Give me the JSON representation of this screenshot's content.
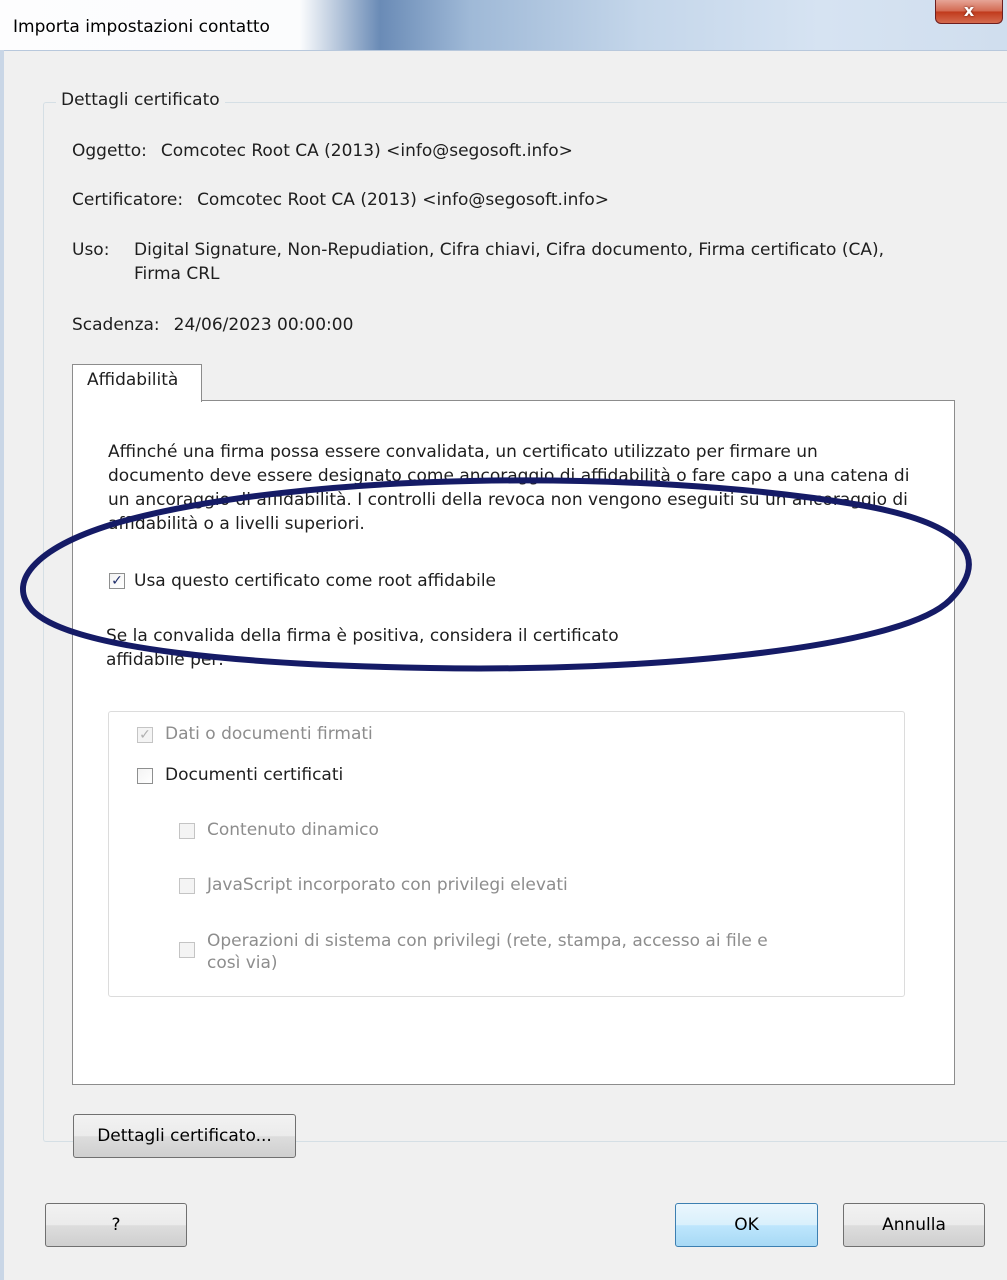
{
  "window": {
    "title": "Importa impostazioni contatto",
    "close_label": "x"
  },
  "details": {
    "legend": "Dettagli certificato",
    "subject_label": "Oggetto:",
    "subject_value": "Comcotec Root CA (2013) <info@segosoft.info>",
    "issuer_label": "Certificatore:",
    "issuer_value": "Comcotec Root CA (2013) <info@segosoft.info>",
    "usage_label": "Uso:",
    "usage_value": "Digital Signature, Non-Repudiation, Cifra chiavi, Cifra documento, Firma certificato (CA), Firma CRL",
    "expiry_label": "Scadenza:",
    "expiry_value": "24/06/2023 00:00:00"
  },
  "tabs": [
    {
      "label": "Affidabilità",
      "active": true
    }
  ],
  "trust": {
    "description": "Affinché una firma possa essere convalidata, un certificato utilizzato per firmare un documento deve essere designato come ancoraggio di affidabilità o fare capo a una catena di un ancoraggio di affidabilità. I controlli della revoca non vengono eseguiti su un ancoraggio di affidabilità o a livelli superiori.",
    "root_checkbox": {
      "label": "Usa questo certificato come root affidabile",
      "checked": true,
      "enabled": true
    },
    "trusted_for_text_line1": "Se la convalida della firma è positiva, considera il certificato",
    "trusted_for_text_line2": "affidabile per:",
    "options": [
      {
        "label": "Dati o documenti firmati",
        "checked": true,
        "enabled": false
      },
      {
        "label": "Documenti certificati",
        "checked": false,
        "enabled": true
      },
      {
        "label": "Contenuto dinamico",
        "checked": false,
        "enabled": false
      },
      {
        "label": "JavaScript incorporato con privilegi elevati",
        "checked": false,
        "enabled": false
      },
      {
        "label_line1": "Operazioni di sistema con privilegi (rete, stampa, accesso ai file e",
        "label_line2": "così via)",
        "checked": false,
        "enabled": false
      }
    ]
  },
  "buttons": {
    "cert_details": "Dettagli certificato...",
    "help": "?",
    "ok": "OK",
    "cancel": "Annulla"
  },
  "colors": {
    "annotation_ellipse": "#151b66",
    "ok_button_border": "#3c7fb1",
    "close_button": "#c0391b"
  }
}
